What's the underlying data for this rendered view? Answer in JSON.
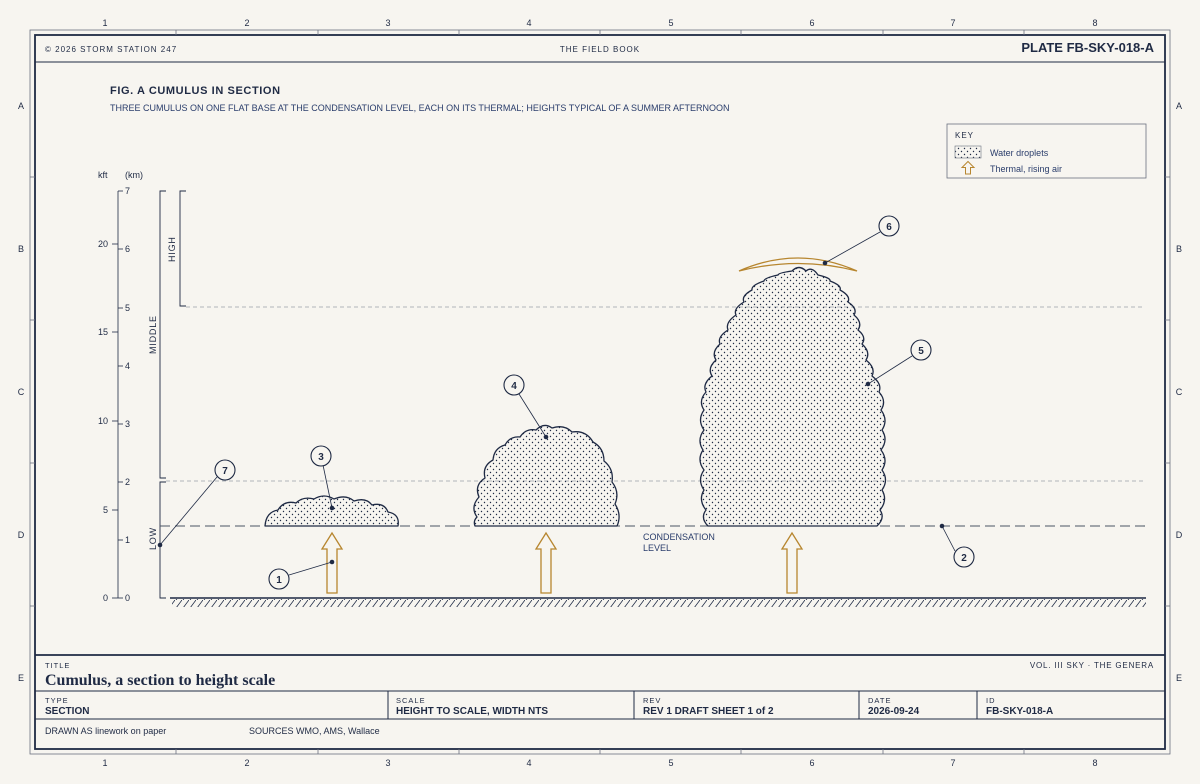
{
  "grid": {
    "columns": [
      "1",
      "2",
      "3",
      "4",
      "5",
      "6",
      "7",
      "8"
    ],
    "rows": [
      "A",
      "B",
      "C",
      "D",
      "E"
    ]
  },
  "header": {
    "copyright": "© 2026 STORM STATION 247",
    "book": "THE FIELD BOOK",
    "plate": "PLATE FB-SKY-018-A"
  },
  "figure": {
    "title": "FIG. A CUMULUS IN SECTION",
    "subtitle": "THREE CUMULUS ON ONE FLAT BASE AT THE CONDENSATION LEVEL, EACH ON ITS THERMAL; HEIGHTS TYPICAL OF A SUMMER AFTERNOON"
  },
  "axis": {
    "kft_label": "kft",
    "km_label": "(km)",
    "kft_ticks": [
      "0",
      "5",
      "10",
      "15",
      "20"
    ],
    "km_ticks": [
      "0",
      "1",
      "2",
      "3",
      "4",
      "5",
      "6",
      "7"
    ],
    "bands": {
      "low": "LOW",
      "middle": "MIDDLE",
      "high": "HIGH"
    }
  },
  "key": {
    "title": "KEY",
    "items": [
      "Water droplets",
      "Thermal, rising air"
    ]
  },
  "labels": {
    "condensation": [
      "CONDENSATION",
      "LEVEL"
    ]
  },
  "callouts": [
    "1",
    "2",
    "3",
    "4",
    "5",
    "6",
    "7"
  ],
  "colors": {
    "ink": "#1f2a44",
    "thermal": "#b7862f",
    "paper": "#f7f5f0",
    "guide": "#9aa0a8"
  },
  "title_block": {
    "title_label": "TITLE",
    "title": "Cumulus, a section to height scale",
    "volume": "VOL. III SKY · THE GENERA",
    "type_label": "TYPE",
    "type": "SECTION",
    "scale_label": "SCALE",
    "scale": "HEIGHT TO SCALE, WIDTH NTS",
    "rev_label": "REV",
    "rev": "REV 1 DRAFT SHEET 1 of 2",
    "date_label": "DATE",
    "date": "2026-09-24",
    "id_label": "ID",
    "id": "FB-SKY-018-A",
    "drawn": "DRAWN AS linework on paper",
    "sources": "SOURCES WMO, AMS, Wallace"
  }
}
